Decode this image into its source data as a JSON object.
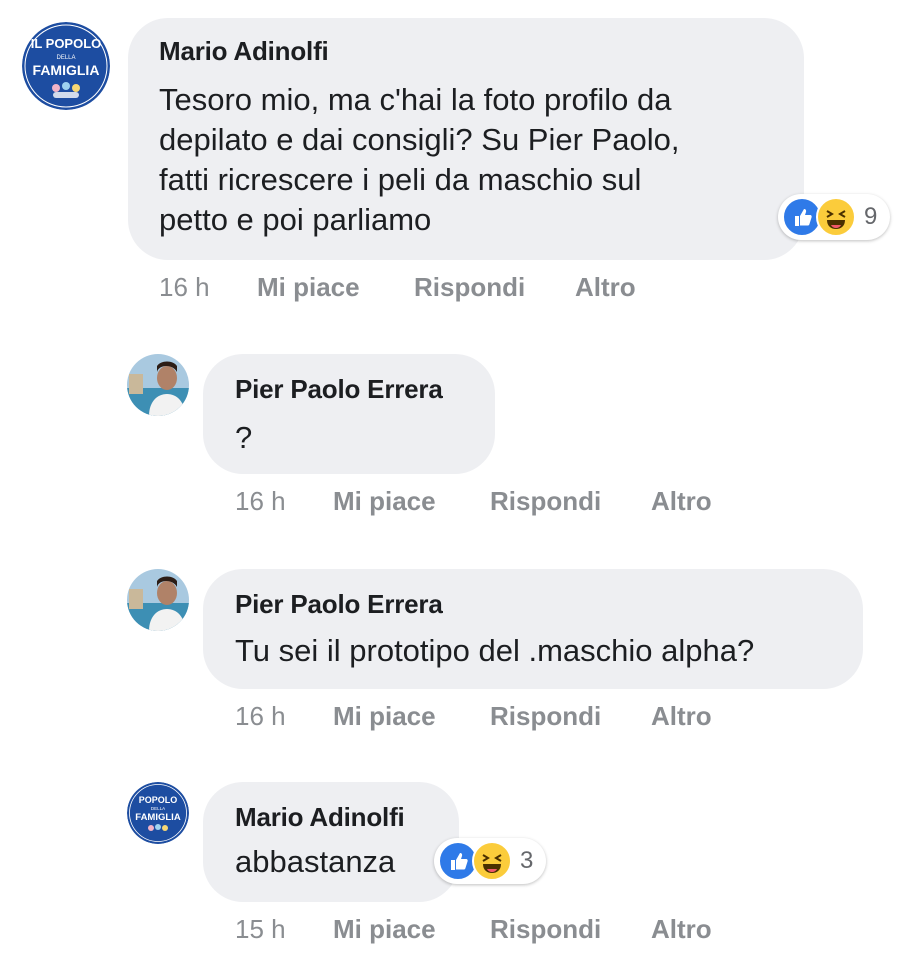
{
  "colors": {
    "bubble": "#eeeff2",
    "action_text": "#8a8d91",
    "like_blue": "#2f7ae8",
    "haha_yellow": "#fbcc3b",
    "logo_blue": "#1d4da1"
  },
  "comments": [
    {
      "avatar": "popolo-famiglia-logo",
      "avatar_lines": [
        "IL POPOLO",
        "DELLA",
        "FAMIGLIA"
      ],
      "author": "Mario Adinolfi",
      "text_lines": [
        "Tesoro mio, ma c'hai la foto profilo da",
        "depilato e dai consigli? Su Pier Paolo,",
        "fatti ricrescere i peli da maschio sul",
        "petto e poi parliamo"
      ],
      "reactions": {
        "icons": [
          "like-icon",
          "haha-icon"
        ],
        "count": "9"
      },
      "time": "16 h",
      "like_label": "Mi piace",
      "reply_label": "Rispondi",
      "more_label": "Altro"
    },
    {
      "avatar": "user-photo",
      "author": "Pier Paolo Errera",
      "text_lines": [
        "?"
      ],
      "time": "16 h",
      "like_label": "Mi piace",
      "reply_label": "Rispondi",
      "more_label": "Altro"
    },
    {
      "avatar": "user-photo",
      "author": "Pier Paolo Errera",
      "text_lines": [
        "Tu sei il prototipo del .maschio alpha?"
      ],
      "time": "16 h",
      "like_label": "Mi piace",
      "reply_label": "Rispondi",
      "more_label": "Altro"
    },
    {
      "avatar": "popolo-famiglia-logo",
      "avatar_lines": [
        "POPOLO",
        "DELLA",
        "FAMIGLIA"
      ],
      "author": "Mario Adinolfi",
      "text_lines": [
        "abbastanza"
      ],
      "reactions": {
        "icons": [
          "like-icon",
          "haha-icon"
        ],
        "count": "3"
      },
      "time": "15 h",
      "like_label": "Mi piace",
      "reply_label": "Rispondi",
      "more_label": "Altro"
    }
  ]
}
